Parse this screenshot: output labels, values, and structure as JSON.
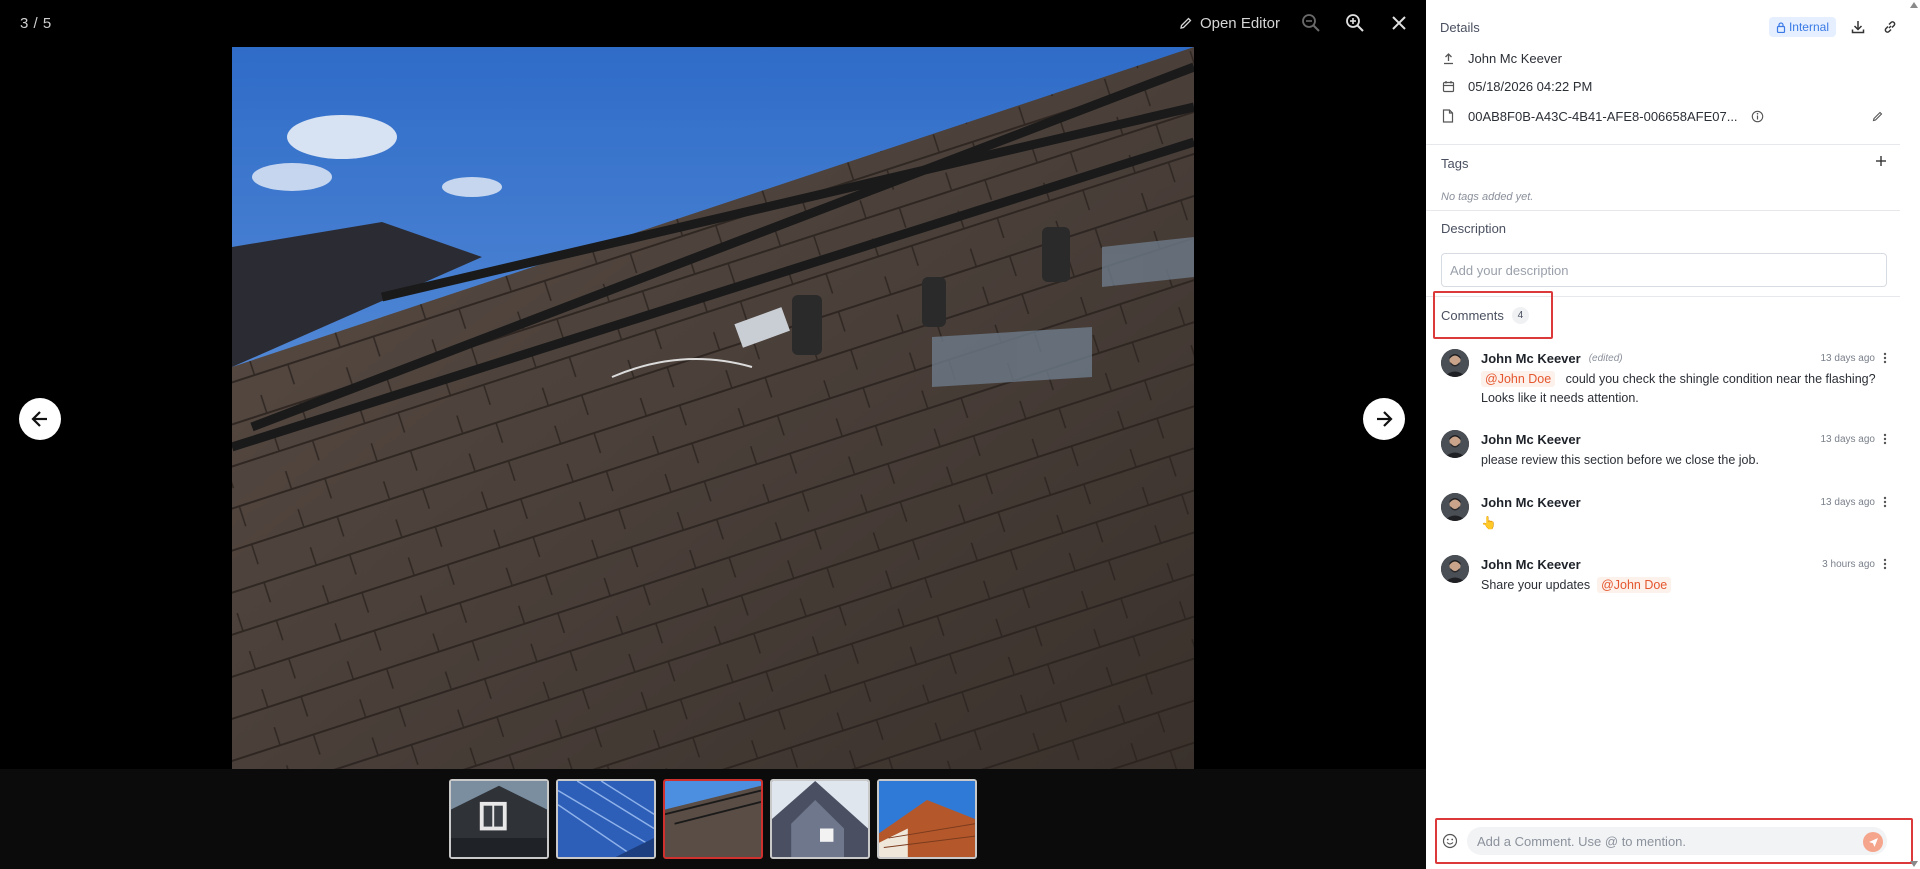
{
  "viewer": {
    "counter": "3 / 5",
    "open_editor_label": "Open Editor",
    "icons": [
      "pencil-icon",
      "zoom-out-icon",
      "zoom-in-icon",
      "close-icon",
      "arrow-left-icon",
      "arrow-right-icon"
    ]
  },
  "thumbnails": {
    "active_index": 2,
    "items": [
      "Thumbnail 1",
      "Thumbnail 2",
      "Thumbnail 3",
      "Thumbnail 4",
      "Thumbnail 5"
    ]
  },
  "sidebar": {
    "details_title": "Details",
    "internal_badge": "Internal",
    "uploader": "John Mc Keever",
    "date": "05/18/2026 04:22 PM",
    "file_id": "00AB8F0B-A43C-4B41-AFE8-006658AFE07...",
    "tags_title": "Tags",
    "tags_empty": "No tags added yet.",
    "description_title": "Description",
    "description_placeholder": "Add your description",
    "comments_title": "Comments",
    "comments_count": "4",
    "comments": [
      {
        "author": "John Mc Keever",
        "edited": "(edited)",
        "time": "13 days ago",
        "mention": "@John Doe",
        "text": "could you check the shingle condition near the flashing? Looks like it needs attention."
      },
      {
        "author": "John Mc Keever",
        "time": "13 days ago",
        "text": "please review this section before we close the job."
      },
      {
        "author": "John Mc Keever",
        "time": "13 days ago",
        "text": "👆"
      },
      {
        "author": "John Mc Keever",
        "time": "3 hours ago",
        "text": "Share your updates",
        "mention": "@John Doe"
      }
    ],
    "comment_input_placeholder": "Add a Comment. Use @ to mention."
  },
  "colors": {
    "accent": "#3b7ae6",
    "highlight": "#dc3a3a",
    "mention": "#e4572e",
    "send": "#f4a58c"
  }
}
